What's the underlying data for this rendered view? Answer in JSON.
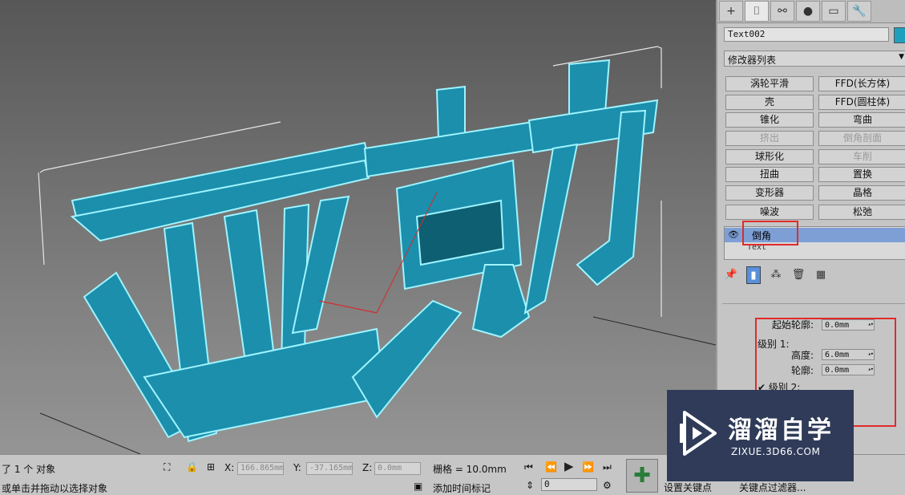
{
  "viewport": {
    "label": "3D viewport - beveled text 亚克力"
  },
  "command_panel": {
    "tabs": [
      {
        "icon": "create-icon",
        "glyph": "+"
      },
      {
        "icon": "modify-icon",
        "glyph": "⌷"
      },
      {
        "icon": "hierarchy-icon",
        "glyph": "⚯"
      },
      {
        "icon": "motion-icon",
        "glyph": "●"
      },
      {
        "icon": "display-icon",
        "glyph": "▭"
      },
      {
        "icon": "utilities-icon",
        "glyph": "🔧"
      }
    ],
    "object_name": "Text002",
    "object_color": "#1ea0bd",
    "modifier_list_label": "修改器列表",
    "modifier_buttons": [
      {
        "label": "涡轮平滑",
        "enabled": true
      },
      {
        "label": "FFD(长方体)",
        "enabled": true
      },
      {
        "label": "壳",
        "enabled": true
      },
      {
        "label": "FFD(圆柱体)",
        "enabled": true
      },
      {
        "label": "锥化",
        "enabled": true
      },
      {
        "label": "弯曲",
        "enabled": true
      },
      {
        "label": "挤出",
        "enabled": false
      },
      {
        "label": "倒角剖面",
        "enabled": false
      },
      {
        "label": "球形化",
        "enabled": true
      },
      {
        "label": "车削",
        "enabled": false
      },
      {
        "label": "扭曲",
        "enabled": true
      },
      {
        "label": "置换",
        "enabled": true
      },
      {
        "label": "变形器",
        "enabled": true
      },
      {
        "label": "晶格",
        "enabled": true
      },
      {
        "label": "噪波",
        "enabled": true
      },
      {
        "label": "松弛",
        "enabled": true
      }
    ],
    "stack": {
      "selected": "倒角",
      "base": "Text"
    },
    "params": {
      "start_outline_label": "起始轮廓:",
      "start_outline_value": "0.0mm",
      "level1_label": "级别 1:",
      "height_label": "高度:",
      "height_value": "6.0mm",
      "outline_label": "轮廓:",
      "outline_value": "0.0mm",
      "level2_label": "✔ 级别 2:"
    }
  },
  "status": {
    "selection": "了 1 个 对象",
    "prompt": "或单击并拖动以选择对象",
    "x_label": "X:",
    "x_value": "166.865mm",
    "y_label": "Y:",
    "y_value": "-37.165mm",
    "z_label": "Z:",
    "z_value": "0.0mm",
    "grid": "栅格 = 10.0mm",
    "add_time_tag": "添加时间标记",
    "frame": "0",
    "set_key": "设置关键点",
    "key_filters": "关键点过滤器..."
  },
  "watermark": {
    "title": "溜溜自学",
    "url": "ZIXUE.3D66.COM"
  }
}
